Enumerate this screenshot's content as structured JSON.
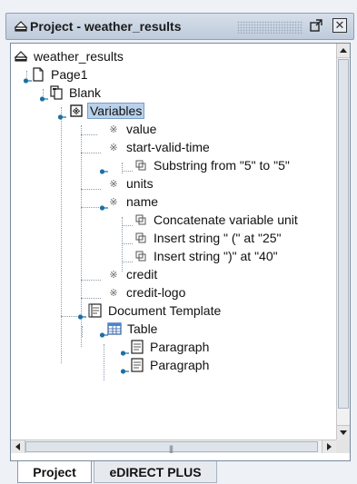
{
  "window": {
    "title": "Project - weather_results",
    "maximize_glyph": "◳",
    "close_glyph": "✕"
  },
  "tree": {
    "nodes": [
      {
        "label": "weather_results",
        "icon": "project-icon"
      },
      {
        "label": "Page1",
        "icon": "page-icon"
      },
      {
        "label": "Blank",
        "icon": "copy-pages-icon"
      },
      {
        "label": "Variables",
        "icon": "variables-icon",
        "selected": true
      },
      {
        "label": "value",
        "icon": "variable-icon"
      },
      {
        "label": "start-valid-time",
        "icon": "variable-icon"
      },
      {
        "label": "Substring from \"5\" to \"5\"",
        "icon": "operation-icon"
      },
      {
        "label": "units",
        "icon": "variable-icon"
      },
      {
        "label": "name",
        "icon": "variable-icon"
      },
      {
        "label": "Concatenate variable unit",
        "icon": "operation-icon"
      },
      {
        "label": "Insert string \" (\" at \"25\"",
        "icon": "operation-icon"
      },
      {
        "label": "Insert string \")\" at \"40\"",
        "icon": "operation-icon"
      },
      {
        "label": "credit",
        "icon": "variable-icon"
      },
      {
        "label": "credit-logo",
        "icon": "variable-icon"
      },
      {
        "label": "Document Template",
        "icon": "document-template-icon"
      },
      {
        "label": "Table",
        "icon": "table-icon"
      },
      {
        "label": "Paragraph",
        "icon": "paragraph-icon"
      },
      {
        "label": "Paragraph",
        "icon": "paragraph-icon"
      }
    ]
  },
  "tabs": [
    {
      "label": "Project",
      "active": true
    },
    {
      "label": "eDIRECT PLUS",
      "active": false
    }
  ],
  "colors": {
    "selection": "#b9d1ea",
    "title_gradient_top": "#d6dfea",
    "title_gradient_bottom": "#bfcbdb"
  }
}
